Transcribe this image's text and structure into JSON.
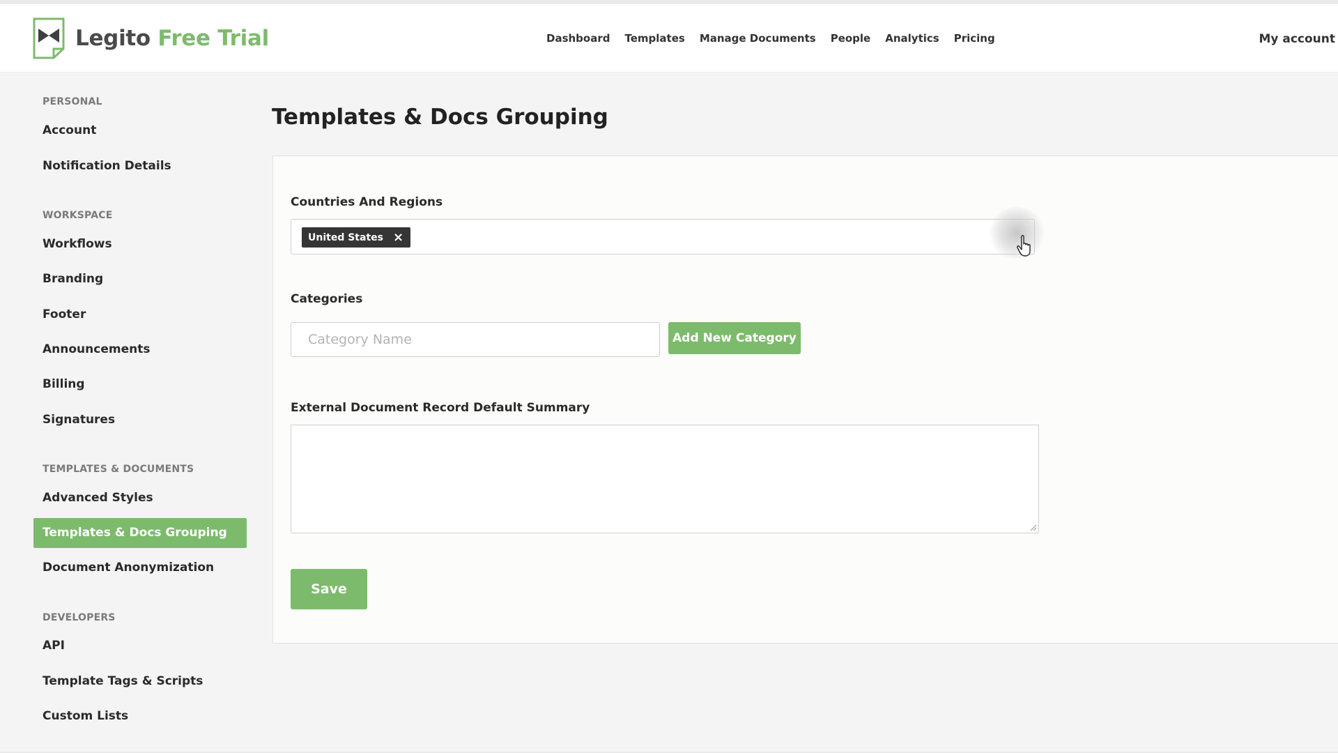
{
  "brand": {
    "name_part1": "Legito",
    "name_part2": "Free Trial",
    "accent_color": "#7dbb6c",
    "logo_icon": "legito-logo-icon"
  },
  "nav": {
    "items": [
      "Dashboard",
      "Templates",
      "Manage Documents",
      "People",
      "Analytics",
      "Pricing"
    ],
    "account": "My account"
  },
  "sidebar": {
    "sections": [
      {
        "title": "PERSONAL",
        "items": [
          "Account",
          "Notification Details"
        ]
      },
      {
        "title": "WORKSPACE",
        "items": [
          "Workflows",
          "Branding",
          "Footer",
          "Announcements",
          "Billing",
          "Signatures"
        ]
      },
      {
        "title": "TEMPLATES & DOCUMENTS",
        "items": [
          "Advanced Styles",
          "Templates & Docs Grouping",
          "Document Anonymization"
        ]
      },
      {
        "title": "DEVELOPERS",
        "items": [
          "API",
          "Template Tags & Scripts",
          "Custom Lists"
        ]
      }
    ],
    "active_item": "Templates & Docs Grouping"
  },
  "main": {
    "title": "Templates & Docs Grouping",
    "countries": {
      "label": "Countries And Regions",
      "selected": [
        "United States"
      ],
      "remove_icon": "close-icon"
    },
    "categories": {
      "label": "Categories",
      "input_value": "",
      "placeholder": "Category Name",
      "add_button": "Add New Category"
    },
    "summary": {
      "label": "External Document Record Default Summary",
      "value": ""
    },
    "save_button": "Save"
  }
}
